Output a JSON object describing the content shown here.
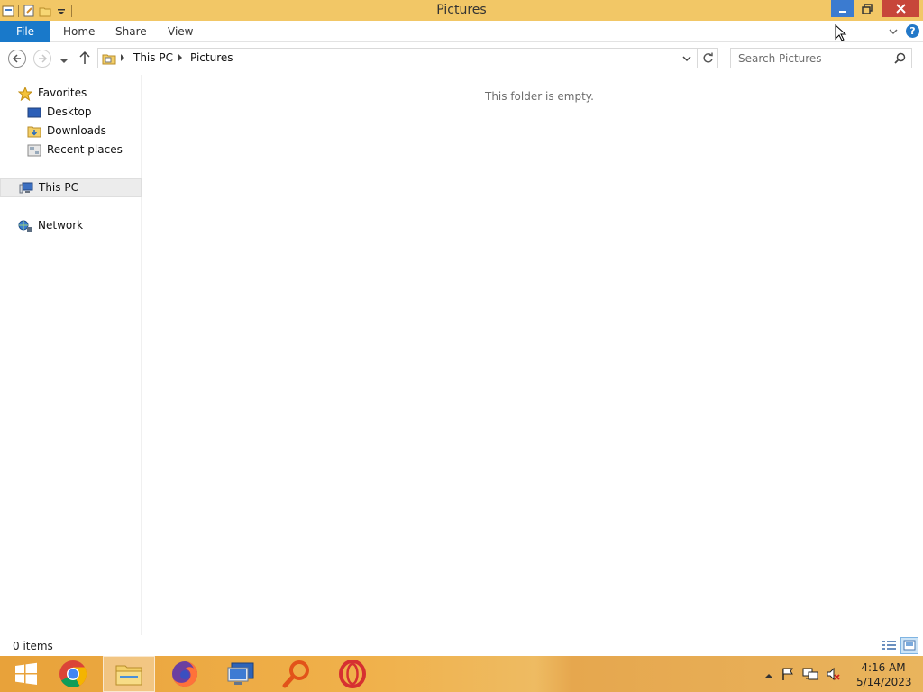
{
  "window": {
    "title": "Pictures"
  },
  "ribbon": {
    "tabs": [
      {
        "label": "File"
      },
      {
        "label": "Home"
      },
      {
        "label": "Share"
      },
      {
        "label": "View"
      }
    ],
    "help_label": "?"
  },
  "address": {
    "breadcrumb": [
      "This PC",
      "Pictures"
    ]
  },
  "search": {
    "placeholder": "Search Pictures"
  },
  "navpane": {
    "favorites": "Favorites",
    "items": [
      "Desktop",
      "Downloads",
      "Recent places"
    ],
    "this_pc": "This PC",
    "network": "Network"
  },
  "content": {
    "empty_message": "This folder is empty."
  },
  "status": {
    "item_count": "0 items"
  },
  "taskbar": {
    "apps": [
      "start-icon",
      "chrome-icon",
      "file-explorer-icon",
      "firefox-icon",
      "remote-desktop-icon",
      "search-tool-icon",
      "opera-icon"
    ]
  },
  "clock": {
    "time": "4:16 AM",
    "date": "5/14/2023"
  },
  "colors": {
    "titlebar": "#f2c766",
    "file_tab": "#1979ca",
    "close_button": "#c7463a",
    "minimize_button": "#3b7bd0"
  }
}
